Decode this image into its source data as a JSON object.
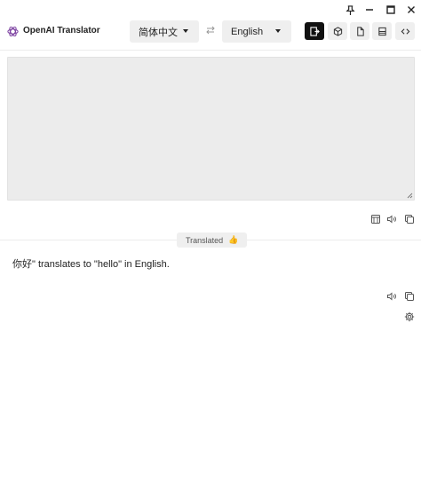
{
  "app": {
    "title": "OpenAI Translator"
  },
  "languages": {
    "source": "简体中文",
    "target": "English"
  },
  "source": {
    "text": "",
    "placeholder": ""
  },
  "status": {
    "label": "Translated",
    "emoji": "👍"
  },
  "result": {
    "text": "你好\" translates to \"hello\" in English."
  },
  "colors": {
    "accent": "#111111",
    "panel": "#ececec",
    "icon": "#555555"
  }
}
